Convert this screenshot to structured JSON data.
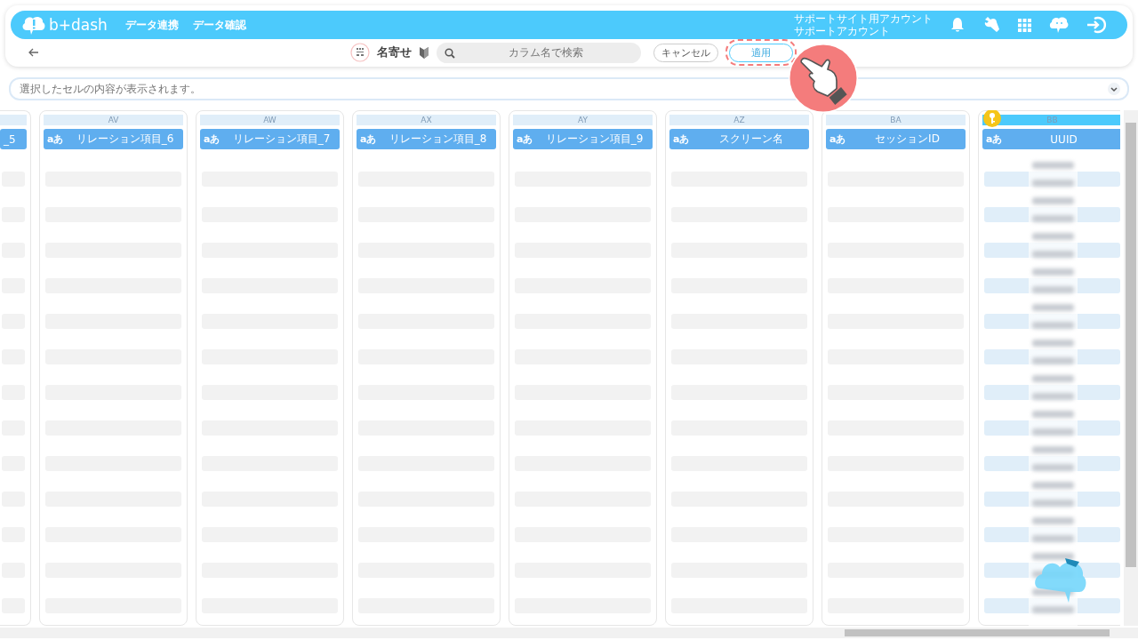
{
  "header": {
    "logo": "b+dash",
    "nav": [
      "データ連携",
      "データ確認"
    ],
    "account": [
      "サポートサイト用アカウント",
      "サポートアカウント"
    ]
  },
  "toolbar": {
    "title": "名寄せ",
    "search": {
      "placeholder": "カラム名で検索"
    },
    "cancel": "キャンセル",
    "apply": "適用",
    "apply_highlighted": true
  },
  "cell_bar": {
    "placeholder": "選択したセルの内容が表示されます。"
  },
  "columns": [
    {
      "kind": "partial",
      "name": "_5",
      "key": false
    },
    {
      "kind": "full",
      "letter": "AV",
      "type_label": "aあ",
      "name": "リレーション項目_6",
      "key": false
    },
    {
      "kind": "full",
      "letter": "AW",
      "type_label": "aあ",
      "name": "リレーション項目_7",
      "key": false
    },
    {
      "kind": "full",
      "letter": "AX",
      "type_label": "aあ",
      "name": "リレーション項目_8",
      "key": false
    },
    {
      "kind": "full",
      "letter": "AY",
      "type_label": "aあ",
      "name": "リレーション項目_9",
      "key": false
    },
    {
      "kind": "full",
      "letter": "AZ",
      "type_label": "aあ",
      "name": "スクリーン名",
      "key": false
    },
    {
      "kind": "full",
      "letter": "BA",
      "type_label": "aあ",
      "name": "セッションID",
      "key": false
    },
    {
      "kind": "full",
      "letter": "BB",
      "type_label": "aあ",
      "name": "UUID",
      "key": true
    }
  ]
}
